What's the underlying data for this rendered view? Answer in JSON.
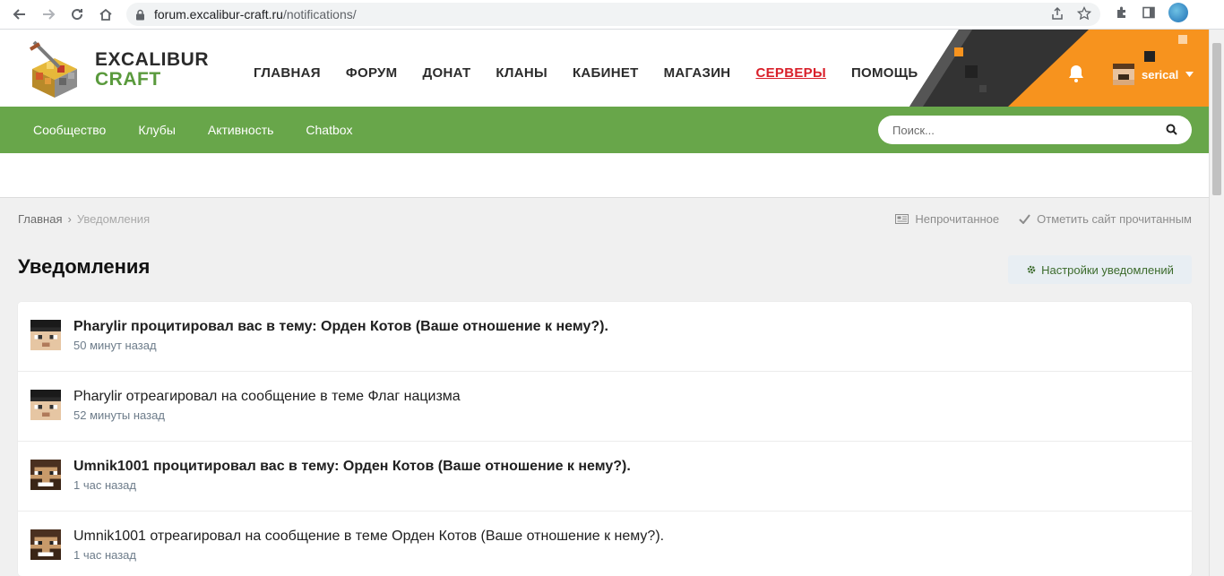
{
  "browser": {
    "url_host": "forum.excalibur-craft.ru",
    "url_path": "/notifications/"
  },
  "logo": {
    "line1": "EXCALIBUR",
    "line2": "CRAFT"
  },
  "main_nav": [
    {
      "label": "ГЛАВНАЯ"
    },
    {
      "label": "ФОРУМ"
    },
    {
      "label": "ДОНАТ"
    },
    {
      "label": "КЛАНЫ"
    },
    {
      "label": "КАБИНЕТ"
    },
    {
      "label": "МАГАЗИН"
    },
    {
      "label": "СЕРВЕРЫ"
    },
    {
      "label": "ПОМОЩЬ"
    }
  ],
  "user": {
    "name": "serical"
  },
  "sub_nav": [
    {
      "label": "Сообщество"
    },
    {
      "label": "Клубы"
    },
    {
      "label": "Активность"
    },
    {
      "label": "Chatbox"
    }
  ],
  "search": {
    "placeholder": "Поиск..."
  },
  "breadcrumb": {
    "home": "Главная",
    "separator": "›",
    "current": "Уведомления"
  },
  "crumb_actions": {
    "unread": "Непрочитанное",
    "mark_read": "Отметить сайт прочитанным"
  },
  "page": {
    "title": "Уведомления",
    "settings_label": "Настройки уведомлений"
  },
  "notifications": [
    {
      "text": "Pharylir процитировал вас в тему: Орден Котов (Ваше отношение к нему?).",
      "time": "50 минут назад",
      "unread": true
    },
    {
      "text": "Pharylir отреагировал на сообщение в теме Флаг нацизма",
      "time": "52 минуты назад",
      "unread": false
    },
    {
      "text": "Umnik1001 процитировал вас в тему: Орден Котов (Ваше отношение к нему?).",
      "time": "1 час назад",
      "unread": true
    },
    {
      "text": "Umnik1001 отреагировал на сообщение в теме Орден Котов (Ваше отношение к нему?).",
      "time": "1 час назад",
      "unread": false
    }
  ],
  "colors": {
    "accent_green": "#68a64a",
    "active_red": "#d9202a",
    "header_orange": "#f7931e"
  }
}
